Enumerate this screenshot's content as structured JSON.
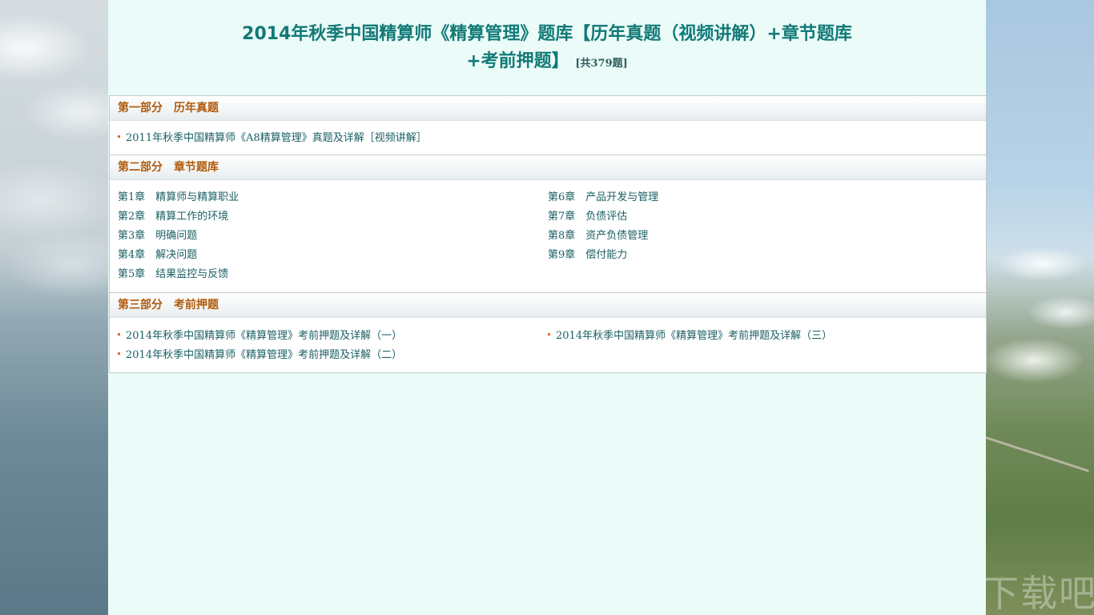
{
  "title": {
    "line1": "2014年秋季中国精算师《精算管理》题库【历年真题（视频讲解）+章节题库",
    "line2": "+考前押题】",
    "count": "[共379题]"
  },
  "sections": [
    {
      "header": "第一部分　历年真题",
      "items": [
        {
          "label": "2011年秋季中国精算师《A8精算管理》真题及详解［视频讲解］"
        }
      ]
    },
    {
      "header": "第二部分　章节题库",
      "chapters_left": [
        {
          "num": "第1章",
          "name": "精算师与精算职业"
        },
        {
          "num": "第2章",
          "name": "精算工作的环境"
        },
        {
          "num": "第3章",
          "name": "明确问题"
        },
        {
          "num": "第4章",
          "name": "解决问题"
        },
        {
          "num": "第5章",
          "name": "结果监控与反馈"
        }
      ],
      "chapters_right": [
        {
          "num": "第6章",
          "name": "产品开发与管理"
        },
        {
          "num": "第7章",
          "name": "负债评估"
        },
        {
          "num": "第8章",
          "name": "资产负债管理"
        },
        {
          "num": "第9章",
          "name": "偿付能力"
        }
      ]
    },
    {
      "header": "第三部分　考前押题",
      "items_left": [
        {
          "label": "2014年秋季中国精算师《精算管理》考前押题及详解（一）"
        },
        {
          "label": "2014年秋季中国精算师《精算管理》考前押题及详解（二）"
        }
      ],
      "items_right": [
        {
          "label": "2014年秋季中国精算师《精算管理》考前押题及详解（三）"
        }
      ]
    }
  ],
  "colors": {
    "title": "#127a77",
    "section_header": "#b15a0b",
    "link": "#1a5f63",
    "bullet": "#e0682a",
    "content_bg": "#ebfbf8"
  }
}
